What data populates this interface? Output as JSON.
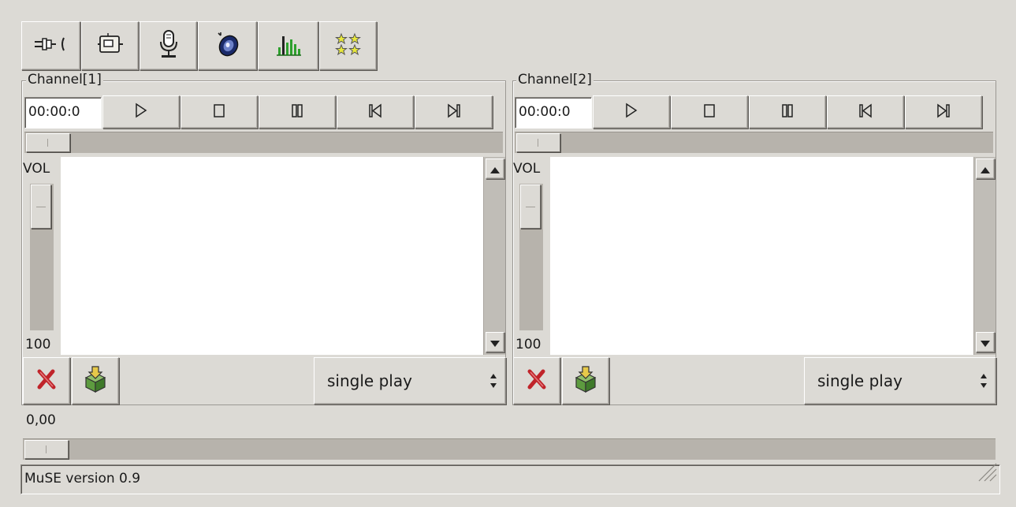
{
  "toolbar": {
    "icons": [
      "plug-icon",
      "network-card-icon",
      "microphone-icon",
      "speaker-icon",
      "bar-meter-icon",
      "stars-icon"
    ]
  },
  "channels": [
    {
      "title": "Channel[1]",
      "time": "00:00:0",
      "vol_label": "VOL",
      "vol_value": "100",
      "mode": "single play",
      "position": 0,
      "volume_level": 1.0
    },
    {
      "title": "Channel[2]",
      "time": "00:00:0",
      "vol_label": "VOL",
      "vol_value": "100",
      "mode": "single play",
      "position": 0,
      "volume_level": 1.0
    }
  ],
  "master": {
    "value": "0,00"
  },
  "statusbar": {
    "text": "MuSE version 0.9"
  },
  "colors": {
    "background": "#dcdad5",
    "delete_red": "#c0242a",
    "meter_green": "#2ea02e",
    "star_yellow": "#e8e83a"
  }
}
